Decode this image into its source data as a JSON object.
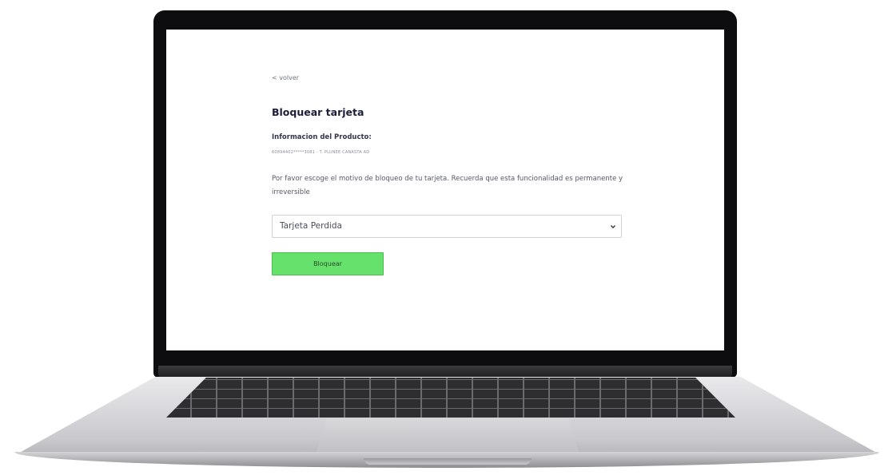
{
  "nav": {
    "back_label": "< volver"
  },
  "page": {
    "title": "Bloquear tarjeta"
  },
  "product": {
    "section_title": "Informacion del Producto:",
    "number_line": "60894402*****3081 - T. PLUNEE CANASTA AD"
  },
  "form": {
    "instruction": "Por favor escoge el motivo de bloqueo de tu tarjeta. Recuerda que esta funcionalidad es permanente y irreversible",
    "reason_selected": "Tarjeta Perdida",
    "submit_label": "Bloquear"
  },
  "colors": {
    "accent_green": "#66e16b",
    "title_navy": "#1b1d3a",
    "device_bezel": "#0d0d0f"
  },
  "icons": {
    "select_arrow": "chevron-down-icon"
  }
}
